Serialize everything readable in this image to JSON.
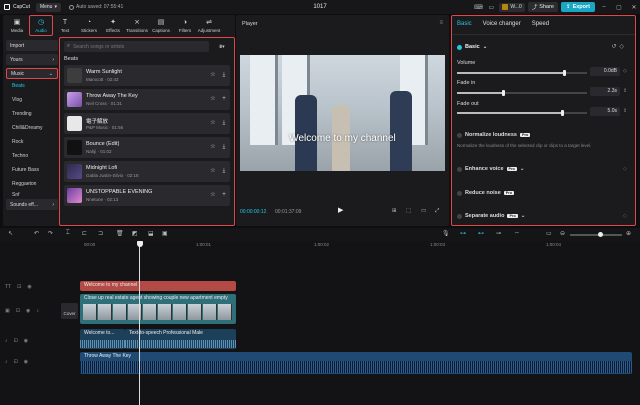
{
  "titlebar": {
    "app_name": "CapCut",
    "menu_label": "Menu",
    "autosave": "Auto saved: 07:55:41",
    "project_title": "1017",
    "user_label": "W...0",
    "share_label": "Share",
    "export_label": "Export"
  },
  "tools": [
    {
      "label": "Media",
      "icon": "media-icon"
    },
    {
      "label": "Audio",
      "icon": "audio-icon"
    },
    {
      "label": "Text",
      "icon": "text-icon"
    },
    {
      "label": "Stickers",
      "icon": "stickers-icon"
    },
    {
      "label": "Effects",
      "icon": "effects-icon"
    },
    {
      "label": "Transitions",
      "icon": "transitions-icon"
    },
    {
      "label": "Captions",
      "icon": "captions-icon"
    },
    {
      "label": "Filters",
      "icon": "filters-icon"
    },
    {
      "label": "Adjustment",
      "icon": "adjustment-icon"
    }
  ],
  "categories": {
    "import": "Import",
    "yours": "Yours",
    "music": "Music",
    "items": [
      "Beats",
      "Vlog",
      "Trending",
      "Chill&Dreamy",
      "Rock",
      "Techno",
      "Future Bass",
      "Reggaeton",
      "Snf"
    ],
    "sound_effects": "Sounds eff..."
  },
  "music_list": {
    "search_placeholder": "Search songs or artists",
    "heading": "Beats",
    "tracks": [
      {
        "name": "Warm Sunlight",
        "meta": "Marxcott · 02:42"
      },
      {
        "name": "Throw Away The Key",
        "meta": "Neil Cross · 01:31"
      },
      {
        "name": "電子解放",
        "meta": "P&P Music · 01:56"
      },
      {
        "name": "Bounce (Edit)",
        "meta": "Nahji · 01:02"
      },
      {
        "name": "Midnight Lofi",
        "meta": "Gabla Justin-Silvio · 02:18"
      },
      {
        "name": "UNSTOPPABLE EVENING",
        "meta": "Nnetune · 02:13"
      }
    ]
  },
  "player": {
    "title": "Player",
    "caption": "Welcome to my channel",
    "current_time": "00:00:00:12",
    "total_time": "00:01:37:09"
  },
  "properties": {
    "tabs": [
      "Basic",
      "Voice changer",
      "Speed"
    ],
    "section": "Basic",
    "volume_label": "Volume",
    "volume_value": "0.0dB",
    "volume_level": 0.83,
    "fade_in_label": "Fade in",
    "fade_in_value": "2.3s",
    "fade_in_level": 0.36,
    "fade_out_label": "Fade out",
    "fade_out_value": "5.0s",
    "fade_out_level": 0.81,
    "normalize_label": "Normalize loudness",
    "normalize_desc": "Normalize the loudness of the selected clip or clips to a target level.",
    "enhance_label": "Enhance voice",
    "reduce_label": "Reduce noise",
    "separate_label": "Separate audio",
    "pro_badge": "Pro"
  },
  "timeline": {
    "ruler": [
      "00:00",
      "1:00:01",
      "1:00:02",
      "1:00:03",
      "1:00:04"
    ],
    "text_clip": "Welcome to my channel",
    "video_clip": "Close up real estate agent showing couple new apartment empty",
    "cover_label": "Cover",
    "tts_clip_a": "Welcome to...",
    "tts_clip_b": "Text-to-speech Professional Male",
    "music_clip": "Throw Away The Key"
  },
  "colors": {
    "accent": "#23c8e3",
    "highlight": "#e0474c",
    "text_clip": "#b34a45",
    "video_clip": "#2f6f7a",
    "audio_clip": "#1f4a73"
  }
}
